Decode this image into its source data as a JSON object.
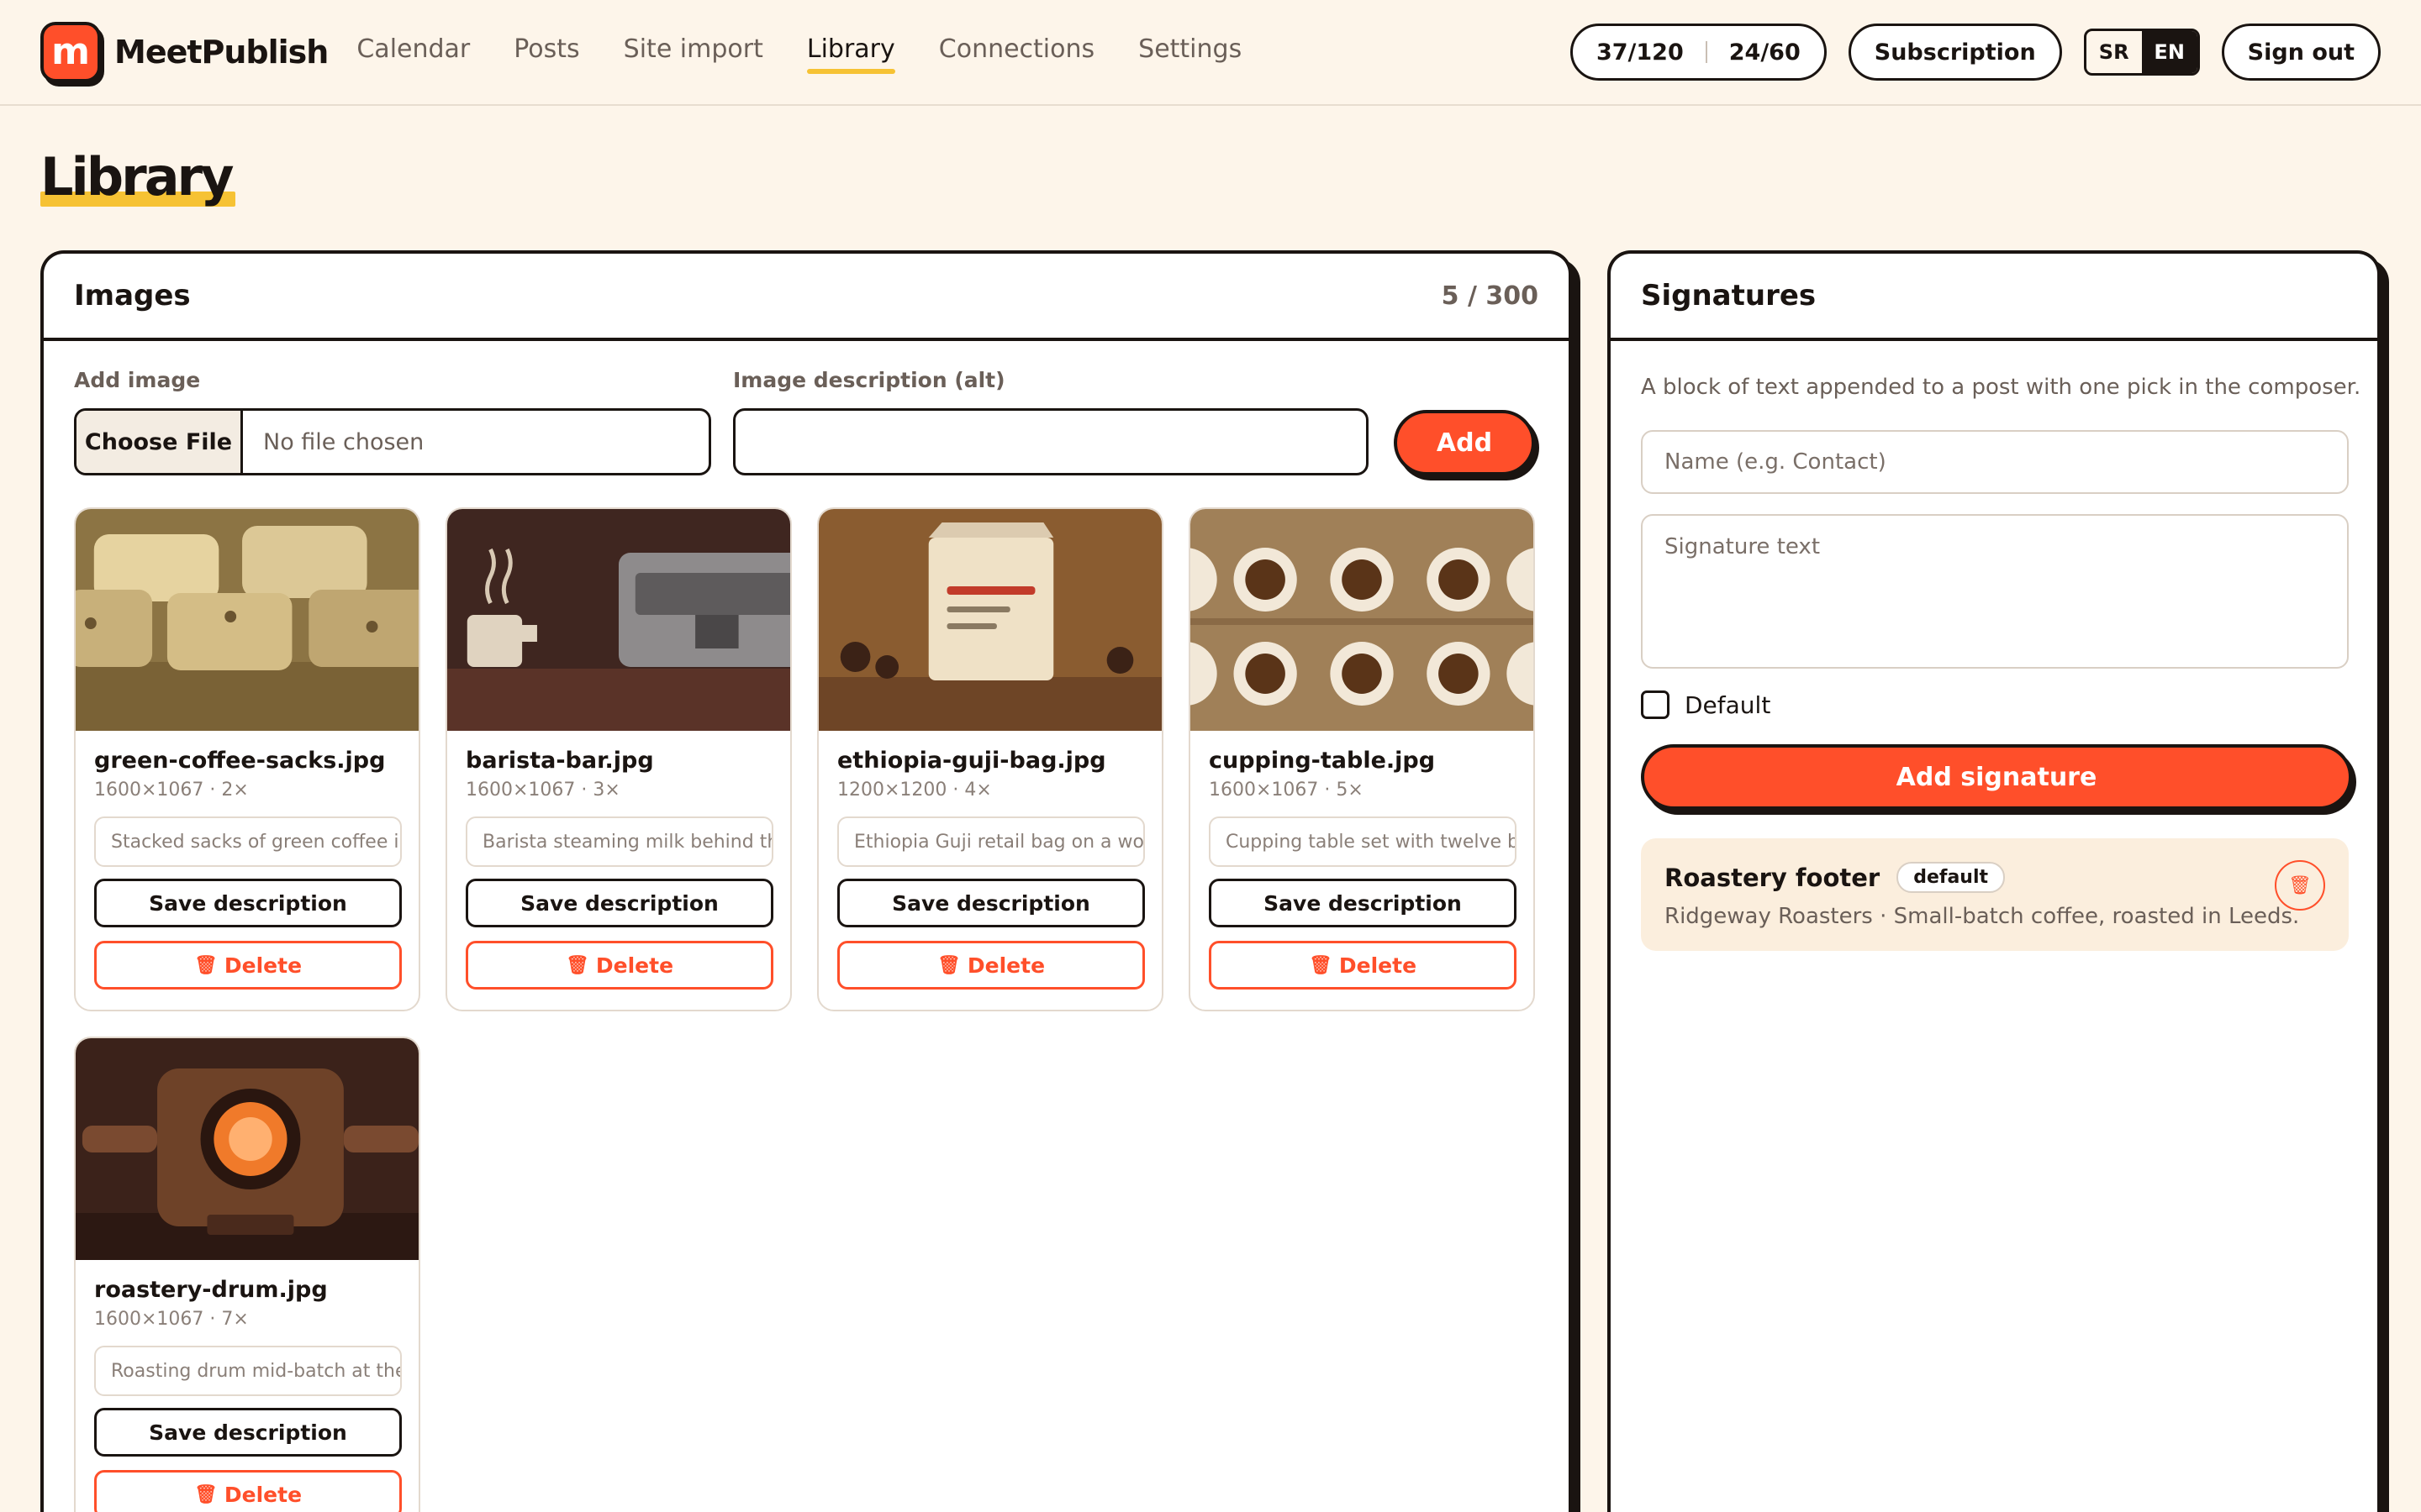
{
  "app": {
    "name": "MeetPublish",
    "logo_letter": "m"
  },
  "nav": {
    "items": [
      {
        "label": "Calendar"
      },
      {
        "label": "Posts"
      },
      {
        "label": "Site import"
      },
      {
        "label": "Library",
        "active": true
      },
      {
        "label": "Connections"
      },
      {
        "label": "Settings"
      }
    ]
  },
  "header": {
    "quota_a": "37/120",
    "quota_b": "24/60",
    "subscription": "Subscription",
    "lang_sr": "SR",
    "lang_en": "EN",
    "sign_out": "Sign out"
  },
  "page": {
    "title": "Library"
  },
  "images": {
    "title": "Images",
    "count": "5 / 300",
    "add_image_label": "Add image",
    "choose_file": "Choose File",
    "no_file": "No file chosen",
    "alt_label": "Image description (alt)",
    "alt_value": "",
    "add_button": "Add",
    "save_label": "Save description",
    "delete_label": "Delete",
    "cards": [
      {
        "name": "green-coffee-sacks.jpg",
        "meta": "1600×1067 · 2×",
        "desc": "Stacked sacks of green coffee i"
      },
      {
        "name": "barista-bar.jpg",
        "meta": "1600×1067 · 3×",
        "desc": "Barista steaming milk behind the"
      },
      {
        "name": "ethiopia-guji-bag.jpg",
        "meta": "1200×1200 · 4×",
        "desc": "Ethiopia Guji retail bag on a woo"
      },
      {
        "name": "cupping-table.jpg",
        "meta": "1600×1067 · 5×",
        "desc": "Cupping table set with twelve bo"
      },
      {
        "name": "roastery-drum.jpg",
        "meta": "1600×1067 · 7×",
        "desc": "Roasting drum mid-batch at the"
      }
    ]
  },
  "signatures": {
    "title": "Signatures",
    "hint": "A block of text appended to a post with one pick in the composer.",
    "name_placeholder": "Name (e.g. Contact)",
    "text_placeholder": "Signature text",
    "default_label": "Default",
    "add_button": "Add signature",
    "items": [
      {
        "name": "Roastery footer",
        "badge": "default",
        "text": "Ridgeway Roasters · Small-batch coffee, roasted in Leeds."
      }
    ]
  },
  "colors": {
    "accent": "#ff4f2a",
    "highlight": "#f6c234",
    "ink": "#1a1411",
    "background": "#fdf5ea"
  }
}
